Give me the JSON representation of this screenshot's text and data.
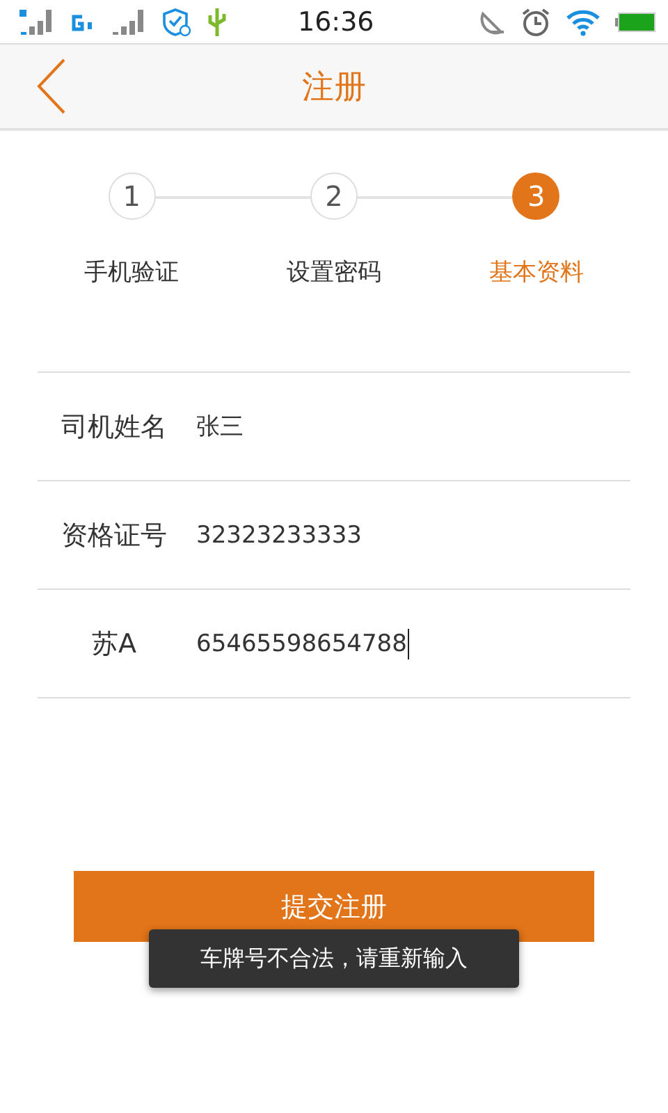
{
  "status_bar": {
    "time": "16:36"
  },
  "nav": {
    "title": "注册"
  },
  "steps": [
    {
      "number": "1",
      "label": "手机验证",
      "selected": false
    },
    {
      "number": "2",
      "label": "设置密码",
      "selected": false
    },
    {
      "number": "3",
      "label": "基本资料",
      "selected": true
    }
  ],
  "fields": [
    {
      "label": "司机姓名",
      "value": "张三",
      "focused": false
    },
    {
      "label": "资格证号",
      "value": "32323233333",
      "focused": false
    },
    {
      "label": "苏A",
      "value": "65465598654788",
      "focused": true
    }
  ],
  "submit_button": "提交注册",
  "toast": "车牌号不合法，请重新输入"
}
